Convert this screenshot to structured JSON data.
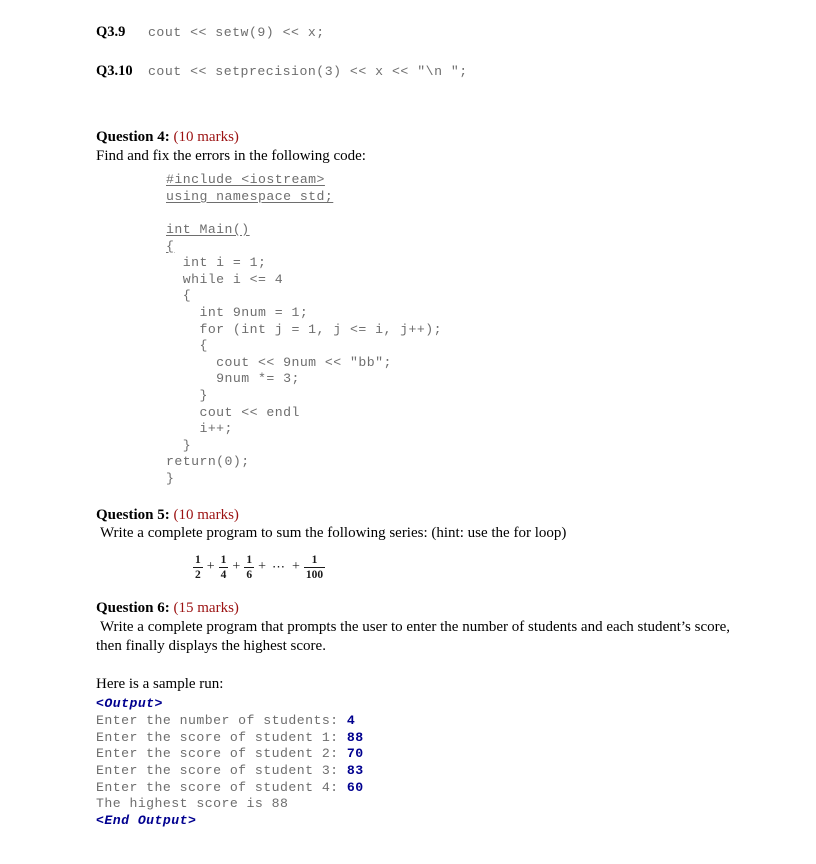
{
  "colors": {
    "marks_red": "#9b1111",
    "code_gray": "#6e6e6e",
    "output_blue": "#00008f",
    "text_black": "#000000",
    "page_bg": "#ffffff"
  },
  "q3_items": [
    {
      "tag": "Q3.9",
      "code": "cout << setw(9) << x;"
    },
    {
      "tag": "Q3.10",
      "code": "cout << setprecision(3) << x << \"\\n \";"
    }
  ],
  "question4": {
    "name": "Question 4:",
    "marks": "(10 marks)",
    "prompt": "Find and fix the errors in the following code:",
    "code_lines": [
      {
        "text": "#include <iostream>",
        "underlined": true
      },
      {
        "text": "using namespace std;",
        "underlined": true
      },
      {
        "text": "",
        "underlined": false
      },
      {
        "text": "int Main()",
        "underlined": true
      },
      {
        "text": "{",
        "underlined": true
      },
      {
        "text": "  int i = 1;",
        "underlined": false
      },
      {
        "text": "  while i <= 4",
        "underlined": false
      },
      {
        "text": "  {",
        "underlined": false
      },
      {
        "text": "    int 9num = 1;",
        "underlined": false
      },
      {
        "text": "    for (int j = 1, j <= i, j++);",
        "underlined": false
      },
      {
        "text": "    {",
        "underlined": false
      },
      {
        "text": "      cout << 9num << \"bb\";",
        "underlined": false
      },
      {
        "text": "      9num *= 3;",
        "underlined": false
      },
      {
        "text": "    }",
        "underlined": false
      },
      {
        "text": "    cout << endl",
        "underlined": false
      },
      {
        "text": "    i++;",
        "underlined": false
      },
      {
        "text": "  }",
        "underlined": false
      },
      {
        "text": "return(0);",
        "underlined": false
      },
      {
        "text": "}",
        "underlined": false
      }
    ]
  },
  "question5": {
    "name": "Question 5:",
    "marks": "(10 marks)",
    "prompt": "Write a complete program to sum the following series: (hint: use the for loop)",
    "series": {
      "terms": [
        {
          "num": "1",
          "den": "2"
        },
        {
          "num": "1",
          "den": "4"
        },
        {
          "num": "1",
          "den": "6"
        }
      ],
      "ellipsis": "⋯",
      "last_term": {
        "num": "1",
        "den": "100"
      },
      "operator": "+"
    }
  },
  "question6": {
    "name": "Question 6:",
    "marks": "(15 marks)",
    "prompt_line1": "Write a complete program that prompts the user to enter the number of students and each student’s score,",
    "prompt_line2": "then finally displays the highest score.",
    "sample_intro": "Here is a sample run:",
    "output_open_tag": "<Output>",
    "output_close_tag": "<End Output>",
    "output_lines": [
      {
        "label": "Enter the number of students: ",
        "value": "4"
      },
      {
        "label": "Enter the score of student 1: ",
        "value": "88"
      },
      {
        "label": "Enter the score of student 2: ",
        "value": "70"
      },
      {
        "label": "Enter the score of student 3: ",
        "value": "83"
      },
      {
        "label": "Enter the score of student 4: ",
        "value": "60"
      }
    ],
    "result_line": "The highest score is 88"
  }
}
